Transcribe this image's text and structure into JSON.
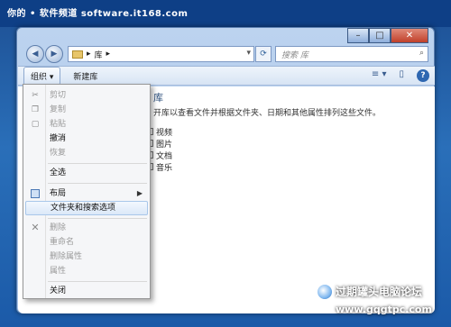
{
  "banner": {
    "text": "你的 • 软件频道 software.it168.com"
  },
  "window": {
    "controls": {
      "minimize": "–",
      "maximize": "□",
      "close": "✕"
    },
    "nav": {
      "back": "◀",
      "forward": "▶"
    },
    "address": {
      "breadcrumb_arrow": "▸",
      "location": "库",
      "sep": "▸"
    },
    "search": {
      "placeholder": "搜索 库",
      "icon": "search-icon"
    }
  },
  "toolbar": {
    "organize_label": "组织 ▾",
    "new_library_label": "新建库",
    "view_icon": "≡ ▾",
    "pane_icon": "▯",
    "help_icon": "?"
  },
  "content": {
    "heading": "库",
    "description": "开库以查看文件并根据文件夹、日期和其他属性排列这些文件。",
    "libraries": [
      "视频",
      "图片",
      "文档",
      "音乐"
    ]
  },
  "menu": {
    "items": [
      {
        "label": "剪切",
        "disabled": true,
        "icon": "cut-icon"
      },
      {
        "label": "复制",
        "disabled": true,
        "icon": "copy-icon"
      },
      {
        "label": "粘贴",
        "disabled": true,
        "icon": "paste-icon"
      },
      {
        "label": "撤消",
        "disabled": false
      },
      {
        "label": "恢复",
        "disabled": true
      },
      {
        "label": "全选",
        "disabled": false
      },
      {
        "label": "布局",
        "disabled": false,
        "submenu": true,
        "icon": "layout-icon"
      },
      {
        "label": "文件夹和搜索选项",
        "disabled": false,
        "highlighted": true
      },
      {
        "label": "删除",
        "disabled": true,
        "icon": "delete-icon"
      },
      {
        "label": "重命名",
        "disabled": true
      },
      {
        "label": "删除属性",
        "disabled": true
      },
      {
        "label": "属性",
        "disabled": true
      },
      {
        "label": "关闭",
        "disabled": false
      }
    ]
  },
  "watermark": {
    "title": "过期罐头电脑论坛",
    "site": "www.gqgtpc.com"
  }
}
